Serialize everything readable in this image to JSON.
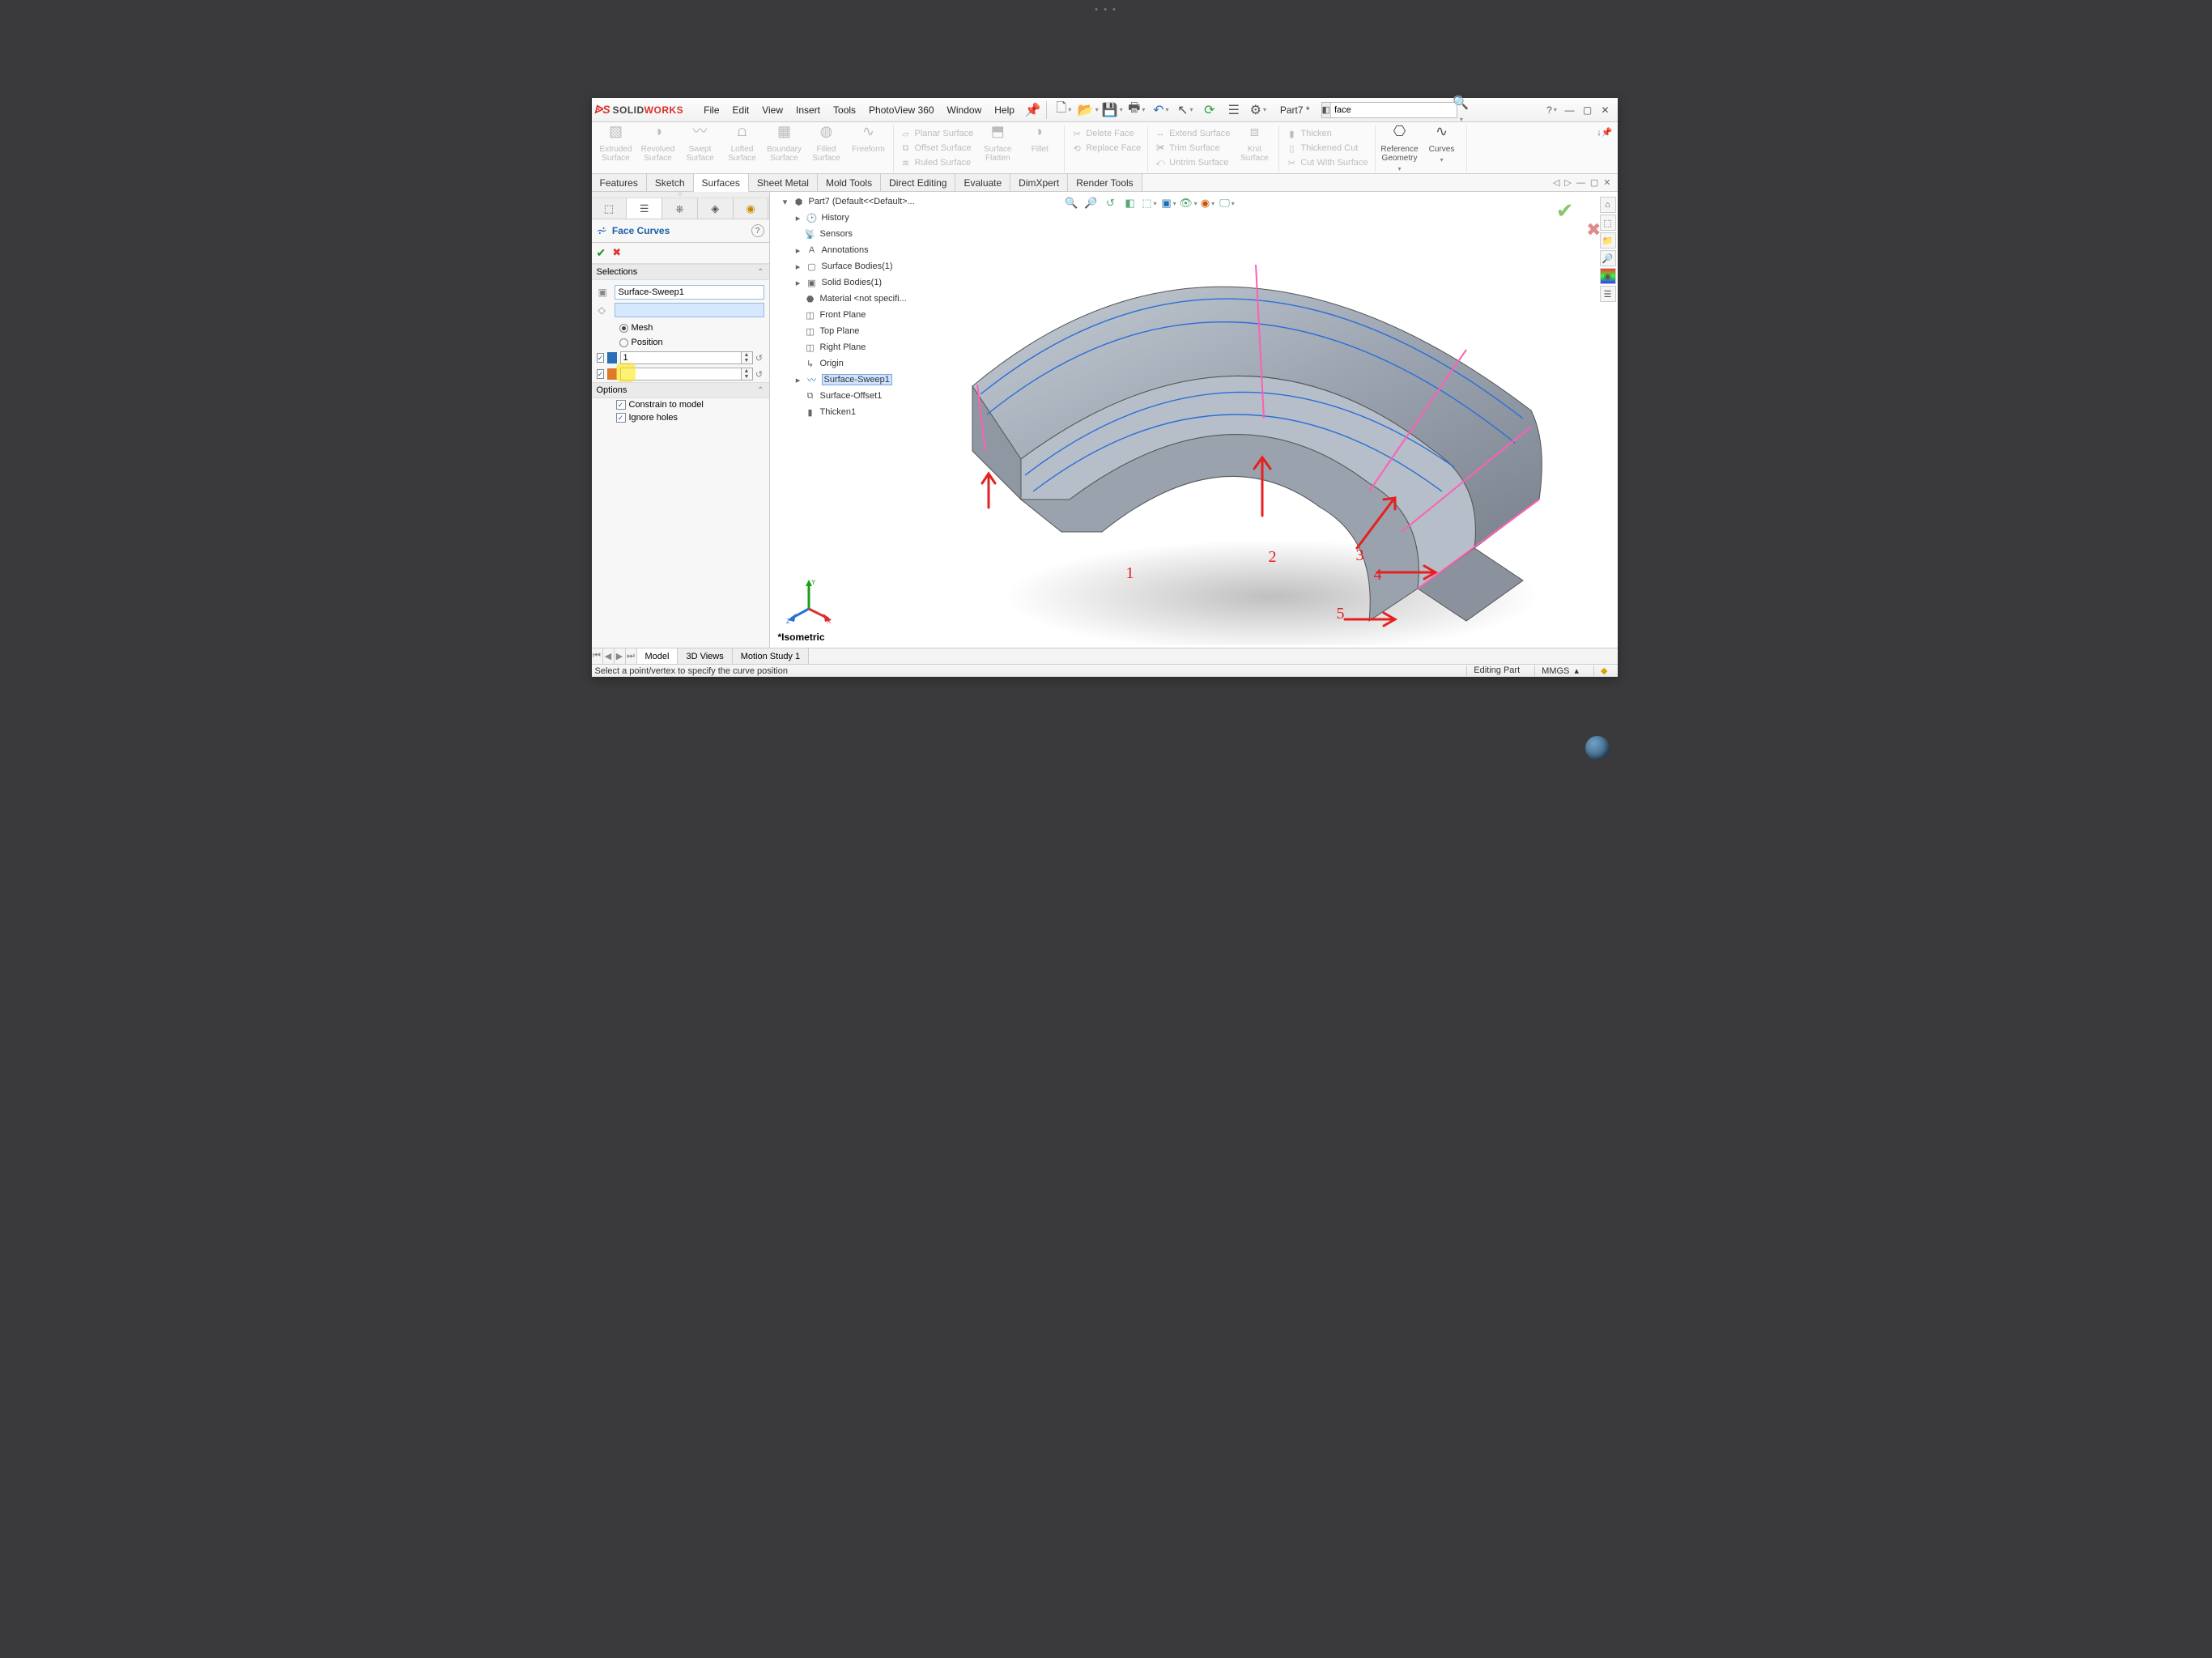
{
  "app": {
    "logo1": "SOLID",
    "logo2": "WORKS",
    "doc_title": "Part7 *",
    "search_value": "face"
  },
  "menu": {
    "file": "File",
    "edit": "Edit",
    "view": "View",
    "insert": "Insert",
    "tools": "Tools",
    "photoview": "PhotoView 360",
    "window": "Window",
    "help": "Help"
  },
  "ribbon": {
    "extruded": "Extruded Surface",
    "revolved": "Revolved Surface",
    "swept": "Swept Surface",
    "lofted": "Lofted Surface",
    "boundary": "Boundary Surface",
    "filled": "Filled Surface",
    "freeform": "Freeform",
    "planar": "Planar Surface",
    "offset": "Offset Surface",
    "ruled": "Ruled Surface",
    "flatten": "Surface Flatten",
    "fillet": "Fillet",
    "delete": "Delete Face",
    "replace": "Replace Face",
    "extend": "Extend Surface",
    "trim": "Trim Surface",
    "untrim": "Untrim Surface",
    "knit": "Knit Surface",
    "thicken": "Thicken",
    "thick_cut": "Thickened Cut",
    "cut_surf": "Cut With Surface",
    "refgeo": "Reference Geometry",
    "curves": "Curves"
  },
  "tabs": {
    "features": "Features",
    "sketch": "Sketch",
    "surfaces": "Surfaces",
    "sheet": "Sheet Metal",
    "mold": "Mold Tools",
    "direct": "Direct Editing",
    "eval": "Evaluate",
    "dimx": "DimXpert",
    "render": "Render Tools"
  },
  "pm": {
    "title": "Face Curves",
    "sec_sel": "Selections",
    "sel_item": "Surface-Sweep1",
    "mesh": "Mesh",
    "position": "Position",
    "num1": "1",
    "num2": "",
    "sec_opt": "Options",
    "constrain": "Constrain to model",
    "ignore": "Ignore holes"
  },
  "tree": {
    "root": "Part7  (Default<<Default>...",
    "history": "History",
    "sensors": "Sensors",
    "annotations": "Annotations",
    "surfbodies": "Surface Bodies(1)",
    "solidbodies": "Solid Bodies(1)",
    "material": "Material <not specifi...",
    "front": "Front Plane",
    "top": "Top Plane",
    "right": "Right Plane",
    "origin": "Origin",
    "sweep": "Surface-Sweep1",
    "offset": "Surface-Offset1",
    "thicken": "Thicken1"
  },
  "viewport": {
    "iso": "*Isometric"
  },
  "btabs": {
    "model": "Model",
    "views3d": "3D Views",
    "motion": "Motion Study 1"
  },
  "status": {
    "hint": "Select a point/vertex to specify the curve position",
    "mode": "Editing Part",
    "units": "MMGS"
  },
  "annotations": {
    "a1": "1",
    "a2": "2",
    "a3": "3",
    "a4": "4",
    "a5": "5"
  }
}
